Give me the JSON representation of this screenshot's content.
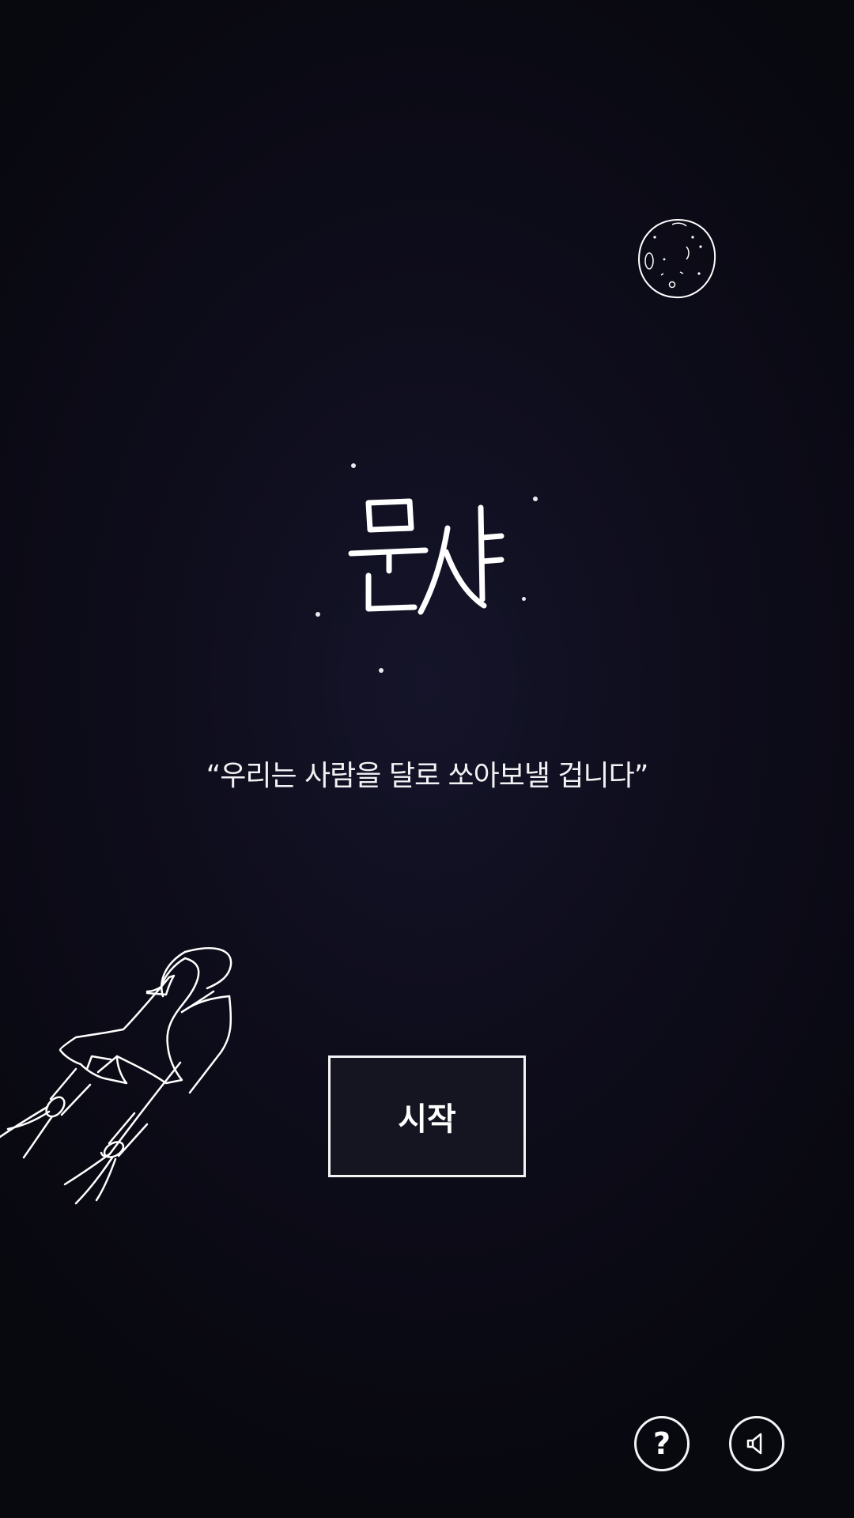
{
  "game": {
    "title": "문샷",
    "tagline": "“우리는 사람을 달로 쏘아보낼 겁니다”"
  },
  "menu": {
    "start_label": "시작"
  },
  "controls": {
    "help_icon": "help-icon",
    "help_glyph": "?",
    "sound_icon": "speaker-icon"
  },
  "colors": {
    "background": "#0b0b16",
    "line": "#ffffff",
    "button_fill": "#151521"
  }
}
